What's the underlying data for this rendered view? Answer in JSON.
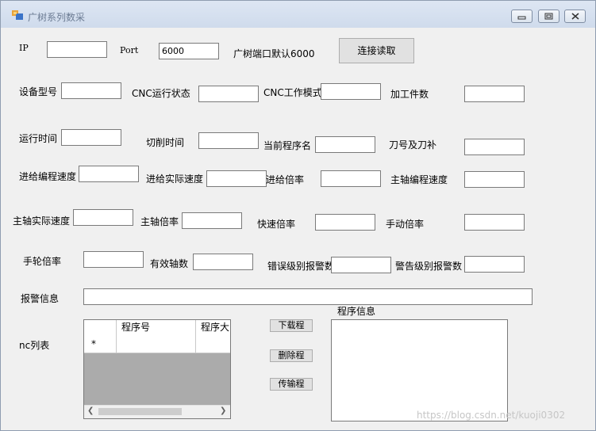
{
  "window": {
    "title": "广树系列数采"
  },
  "labels": {
    "ip": "IP",
    "port": "Port",
    "port_hint": "广树端口默认6000",
    "device_model": "设备型号",
    "cnc_state": "CNC运行状态",
    "cnc_mode": "CNC工作模式",
    "part_count": "加工件数",
    "run_time": "运行时间",
    "cut_time": "切削时间",
    "program_name": "当前程序名",
    "tool_offset": "刀号及刀补",
    "feed_prog_speed": "进给编程速度",
    "feed_actual_speed": "进给实际速度",
    "feed_override": "进给倍率",
    "spindle_prog_speed": "主轴编程速度",
    "spindle_actual_speed": "主轴实际速度",
    "spindle_override": "主轴倍率",
    "rapid_override": "快速倍率",
    "jog_override": "手动倍率",
    "handwheel_override": "手轮倍率",
    "valid_axes": "有效轴数",
    "error_alarm": "错误级别报警数",
    "warning_alarm": "警告级别报警数",
    "alarm_info": "报警信息",
    "nc_list": "nc列表",
    "program_info": "程序信息"
  },
  "inputs": {
    "ip": "",
    "port": "6000"
  },
  "buttons": {
    "connect": "连接读取",
    "download": "下载程",
    "delete": "删除程",
    "transfer": "传输程"
  },
  "grid": {
    "columns": [
      "程序号",
      "程序大"
    ],
    "new_row_marker": "*"
  },
  "watermark": "https://blog.csdn.net/kuoji0302"
}
